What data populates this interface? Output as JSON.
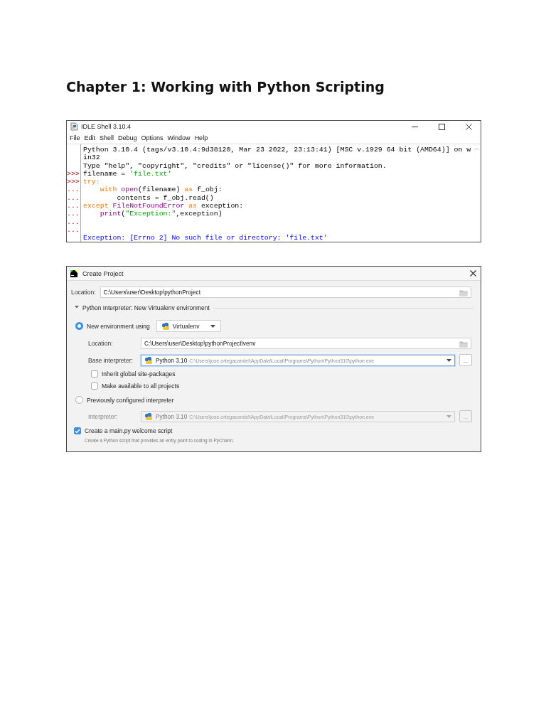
{
  "heading": "Chapter 1: Working with Python Scripting",
  "idle_window": {
    "title": "IDLE Shell 3.10.4",
    "menu": [
      "File",
      "Edit",
      "Shell",
      "Debug",
      "Options",
      "Window",
      "Help"
    ],
    "lines": [
      {
        "tokens": [
          {
            "text": "Python 3.10.4 (tags/v3.10.4:9d38120, Mar 23 2022, 23:13:41) [MSC v.1929 64 bit (AMD64)] on w",
            "kind": "plain"
          }
        ]
      },
      {
        "tokens": [
          {
            "text": "in32",
            "kind": "plain"
          }
        ]
      },
      {
        "tokens": [
          {
            "text": "Type \"help\", \"copyright\", \"credits\" or \"license()\" for more information.",
            "kind": "plain"
          }
        ]
      },
      {
        "prompt": ">>>",
        "tokens": [
          {
            "text": "filename = ",
            "kind": "plain"
          },
          {
            "text": "'file.txt'",
            "kind": "string"
          }
        ]
      },
      {
        "prompt": ">>>",
        "tokens": [
          {
            "text": "try:",
            "kind": "keyword"
          }
        ]
      },
      {
        "prompt": "...",
        "tokens": [
          {
            "text": "    with",
            "kind": "keyword"
          },
          {
            "text": " open",
            "kind": "builtin"
          },
          {
            "text": "(filename) ",
            "kind": "plain"
          },
          {
            "text": "as",
            "kind": "keyword"
          },
          {
            "text": " f_obj:",
            "kind": "plain"
          }
        ]
      },
      {
        "prompt": "...",
        "tokens": [
          {
            "text": "        contents = f_obj.read()",
            "kind": "plain"
          }
        ]
      },
      {
        "prompt": "...",
        "tokens": [
          {
            "text": "except",
            "kind": "keyword"
          },
          {
            "text": " FileNotFoundError",
            "kind": "builtin"
          },
          {
            "text": " as",
            "kind": "keyword"
          },
          {
            "text": " exception:",
            "kind": "plain"
          }
        ]
      },
      {
        "prompt": "...",
        "tokens": [
          {
            "text": "    print",
            "kind": "builtin"
          },
          {
            "text": "(",
            "kind": "plain"
          },
          {
            "text": "\"Exception:\"",
            "kind": "string"
          },
          {
            "text": ",exception)",
            "kind": "plain"
          }
        ]
      },
      {
        "prompt": "..."
      },
      {
        "prompt": "..."
      },
      {
        "tokens": [
          {
            "text": "Exception: [Errno 2] No such file or directory: 'file.txt'",
            "kind": "output"
          }
        ]
      }
    ]
  },
  "create_project": {
    "title": "Create Project",
    "location": {
      "label": "Location:",
      "value": "C:\\Users\\user\\Desktop\\pythonProject"
    },
    "section": {
      "title": "Python Interpreter: New Virtualenv environment",
      "expanded": true
    },
    "new_environment": {
      "label": "New environment using",
      "selected": true,
      "tool": "Virtualenv",
      "location": {
        "label": "Location:",
        "value": "C:\\Users\\user\\Desktop\\pythonProject\\venv"
      },
      "base_interpreter": {
        "label": "Base interpreter:",
        "name": "Python 3.10",
        "path": "C:\\Users\\jose.ortegacandel\\AppData\\Local\\Programs\\Python\\Python310\\python.exe",
        "browse": "..."
      },
      "options": [
        {
          "label": "Inherit global site-packages",
          "checked": false
        },
        {
          "label": "Make available to all projects",
          "checked": false
        }
      ]
    },
    "previous": {
      "label": "Previously configured interpreter",
      "selected": false,
      "interpreter": {
        "label": "Interpreter:",
        "name": "Python 3.10",
        "path": "C:\\Users\\jose.ortegacandel\\AppData\\Local\\Programs\\Python\\Python310\\python.exe",
        "browse": "...",
        "disabled": true
      }
    },
    "welcome_script": {
      "label": "Create a main.py welcome script",
      "checked": true,
      "hint": "Create a Python script that provides an entry point to coding in PyCharm."
    }
  }
}
